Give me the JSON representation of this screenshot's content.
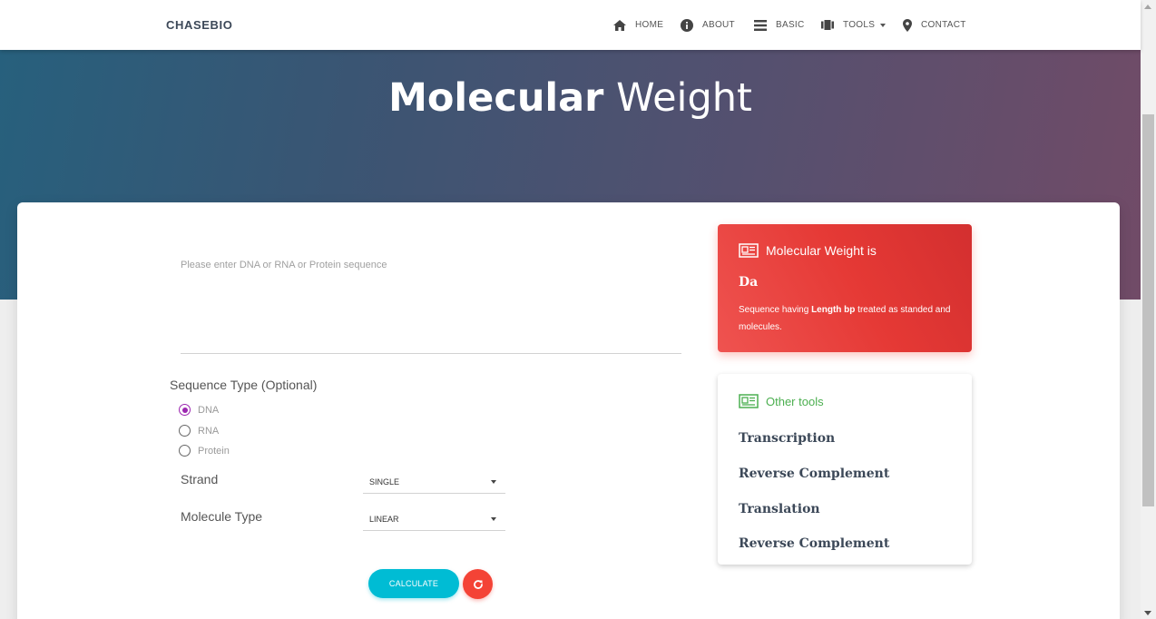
{
  "nav": {
    "brand": "CHASEBIO",
    "items": [
      {
        "label": "HOME",
        "icon": "home-icon"
      },
      {
        "label": "ABOUT",
        "icon": "info-icon"
      },
      {
        "label": "BASIC",
        "icon": "list-icon"
      },
      {
        "label": "TOOLS",
        "icon": "tools-icon",
        "dropdown": true
      },
      {
        "label": "CONTACT",
        "icon": "location-pin-icon"
      }
    ]
  },
  "hero": {
    "title_bold": "Molecular",
    "title_light": "Weight"
  },
  "form": {
    "sequence_placeholder": "Please enter DNA or RNA or Protein sequence",
    "sequence_value": "",
    "sequence_type_label": "Sequence Type (Optional)",
    "sequence_types": [
      {
        "label": "DNA",
        "checked": true
      },
      {
        "label": "RNA",
        "checked": false
      },
      {
        "label": "Protein",
        "checked": false
      }
    ],
    "strand_label": "Strand",
    "strand_value": "SINGLE",
    "molecule_type_label": "Molecule Type",
    "molecule_type_value": "LINEAR",
    "calculate_label": "CALCULATE",
    "refresh_icon": "refresh-icon"
  },
  "result": {
    "header": "Molecular Weight is",
    "value": "Da",
    "desc_prefix": "Sequence having ",
    "desc_bold": "Length bp",
    "desc_suffix": " treated as standed and molecules.",
    "header_icon": "newspaper-icon"
  },
  "other_tools": {
    "header": "Other tools",
    "header_icon": "newspaper-icon",
    "items": [
      "Transcription",
      "Reverse Complement",
      "Translation",
      "Reverse Complement"
    ]
  },
  "colors": {
    "accent_purple": "#9c27b0",
    "calculate_cyan": "#00bcd4",
    "danger_red": "#f44336",
    "success_green": "#4caf50"
  }
}
